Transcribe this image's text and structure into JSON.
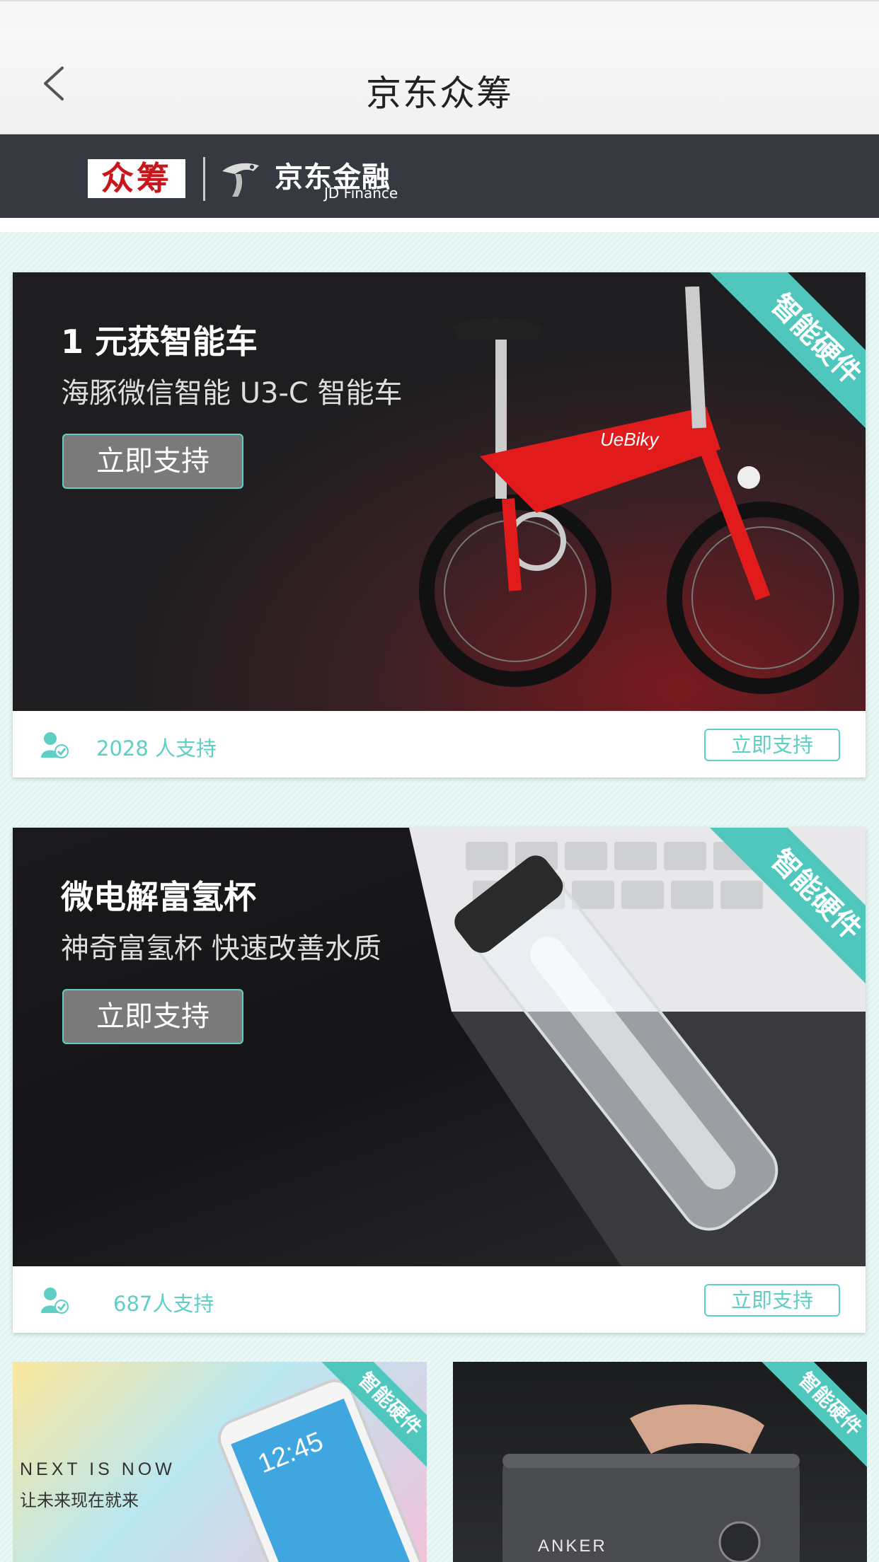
{
  "nav": {
    "title": "京东众筹"
  },
  "brand": {
    "zc_logo": "众筹",
    "jd_finance": "京东金融",
    "jd_finance_en": "JD Finance"
  },
  "cards": [
    {
      "headline": "1 元获智能车",
      "subline": "海豚微信智能 U3-C 智能车",
      "hero_button": "立即支持",
      "ribbon": "智能硬件",
      "support_count": "2028 人支持",
      "support_button": "立即支持",
      "product_brand": "UeBiky"
    },
    {
      "headline": "微电解富氢杯",
      "subline": "神奇富氢杯 快速改善水质",
      "hero_button": "立即支持",
      "ribbon": "智能硬件",
      "support_count": "687人支持",
      "support_button": "立即支持"
    }
  ],
  "small_cards": [
    {
      "ribbon": "智能硬件",
      "tagline_en": "NEXT IS NOW",
      "tagline_cn": "让未来现在就来",
      "clock": "12:45"
    },
    {
      "ribbon": "智能硬件",
      "brand": "ANKER"
    }
  ],
  "colors": {
    "accent": "#4fc7bd",
    "brandbar": "#363a40",
    "logo_red": "#c8161d"
  }
}
